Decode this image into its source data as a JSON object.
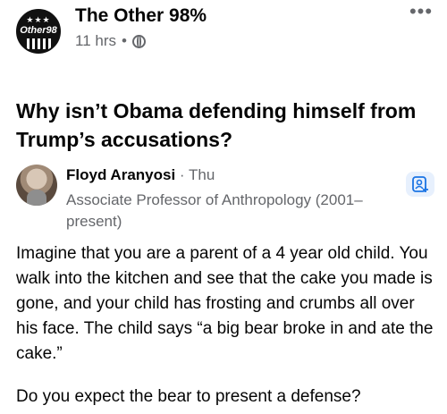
{
  "page": {
    "name": "The Other 98%",
    "time": "11 hrs",
    "separator": "•",
    "avatar_text": "Other98",
    "avatar_stars": "★★★"
  },
  "post": {
    "question": "Why isn’t Obama defending himself from Trump’s accusations?"
  },
  "answer": {
    "author": "Floyd Aranyosi",
    "date": "· Thu",
    "credential": "Associate Professor of Anthropology (2001–present)",
    "body": "Imagine that you are a parent of a 4 year old child. You walk into the kitchen and see that the cake you made is gone, and your child has frosting and crumbs all over his face. The child says “a big bear broke in and ate the cake.”",
    "closing": "Do you expect the bear to present a defense?"
  },
  "icons": {
    "more": "more-icon",
    "globe": "globe-icon",
    "follow": "follow-person-icon"
  },
  "colors": {
    "text": "#050505",
    "muted": "#65676b",
    "follow_bg": "#e7f0fd",
    "follow_icon": "#1b74e4"
  }
}
